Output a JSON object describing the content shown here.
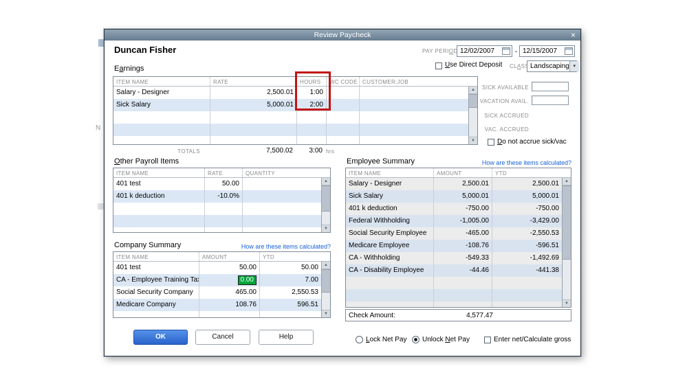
{
  "background": {
    "letter": "N"
  },
  "icons": {
    "close": "×",
    "dropdown": "▾",
    "scroll_up": "▲",
    "scroll_down": "▼"
  },
  "titlebar": {
    "title": "Review Paycheck"
  },
  "header": {
    "employee_name": "Duncan Fisher",
    "pay_period": {
      "label": {
        "pre": "PAY PERI",
        "accel": "O",
        "post": "D"
      },
      "start": "12/02/2007",
      "sep": "-",
      "end": "12/15/2007"
    },
    "direct_deposit": {
      "pre": "",
      "accel": "U",
      "post": "se Direct Deposit"
    },
    "class": {
      "label": {
        "pre": "CL",
        "accel": "A",
        "post": "SS"
      },
      "value": "Landscaping"
    }
  },
  "earnings": {
    "title": {
      "pre": "E",
      "accel": "a",
      "post": "rnings"
    },
    "headers": [
      "ITEM NAME",
      "RATE",
      "HOURS",
      "WC CODE",
      "CUSTOMER:JOB"
    ],
    "rows": [
      {
        "item": "Salary - Designer",
        "rate": "2,500.01",
        "hours": "1:00",
        "wc": "",
        "job": ""
      },
      {
        "item": "Sick Salary",
        "rate": "5,000.01",
        "hours": "2:00",
        "wc": "",
        "job": ""
      }
    ],
    "totals": {
      "label": "TOTALS",
      "rate": "7,500.02",
      "hours": "3:00",
      "unit": "hrs"
    }
  },
  "accruals": {
    "sick_available": "SICK AVAILABLE",
    "vacation_avail": "VACATION AVAIL.",
    "sick_accrued": "SICK ACCRUED",
    "vac_accrued": "VAC. ACCRUED",
    "sick_available_value": "",
    "vacation_avail_value": "",
    "do_not_accrue": {
      "pre": "",
      "accel": "D",
      "post": "o not accrue sick/vac"
    }
  },
  "other_payroll": {
    "title": {
      "pre": "",
      "accel": "O",
      "post": "ther Payroll Items"
    },
    "headers": [
      "ITEM NAME",
      "RATE",
      "QUANTITY"
    ],
    "rows": [
      {
        "item": "401 test",
        "rate": "50.00",
        "qty": ""
      },
      {
        "item": "401 k deduction",
        "rate": "-10.0%",
        "qty": ""
      }
    ]
  },
  "company_summary": {
    "title": "Company Summary",
    "link": "How are these items calculated?",
    "headers": [
      "ITEM NAME",
      "AMOUNT",
      "YTD"
    ],
    "rows": [
      {
        "item": "401 test",
        "amount": "50.00",
        "ytd": "50.00"
      },
      {
        "item": "CA - Employee Training Tax",
        "amount": "0.00",
        "ytd": "7.00",
        "selected": true
      },
      {
        "item": "Social Security Company",
        "amount": "465.00",
        "ytd": "2,550.53"
      },
      {
        "item": "Medicare Company",
        "amount": "108.76",
        "ytd": "596.51"
      }
    ]
  },
  "employee_summary": {
    "title": "Employee Summary",
    "link": "How are these items calculated?",
    "headers": [
      "ITEM NAME",
      "AMOUNT",
      "YTD"
    ],
    "rows": [
      {
        "item": "Salary - Designer",
        "amount": "2,500.01",
        "ytd": "2,500.01"
      },
      {
        "item": "Sick Salary",
        "amount": "5,000.01",
        "ytd": "5,000.01"
      },
      {
        "item": "401 k deduction",
        "amount": "-750.00",
        "ytd": "-750.00"
      },
      {
        "item": "Federal Withholding",
        "amount": "-1,005.00",
        "ytd": "-3,429.00"
      },
      {
        "item": "Social Security Employee",
        "amount": "-465.00",
        "ytd": "-2,550.53"
      },
      {
        "item": "Medicare Employee",
        "amount": "-108.76",
        "ytd": "-596.51"
      },
      {
        "item": "CA - Withholding",
        "amount": "-549.33",
        "ytd": "-1,492.69"
      },
      {
        "item": "CA - Disability Employee",
        "amount": "-44.46",
        "ytd": "-441.38"
      }
    ],
    "check_amount_label": "Check Amount:",
    "check_amount": "4,577.47"
  },
  "buttons": {
    "ok": "OK",
    "cancel": "Cancel",
    "help": "Help"
  },
  "footer": {
    "lock": {
      "pre": "",
      "accel": "L",
      "post": "ock Net Pay"
    },
    "unlock": {
      "pre": "Unlock ",
      "accel": "N",
      "post": "et Pay"
    },
    "enter_net": "Enter net/Calculate gross"
  }
}
